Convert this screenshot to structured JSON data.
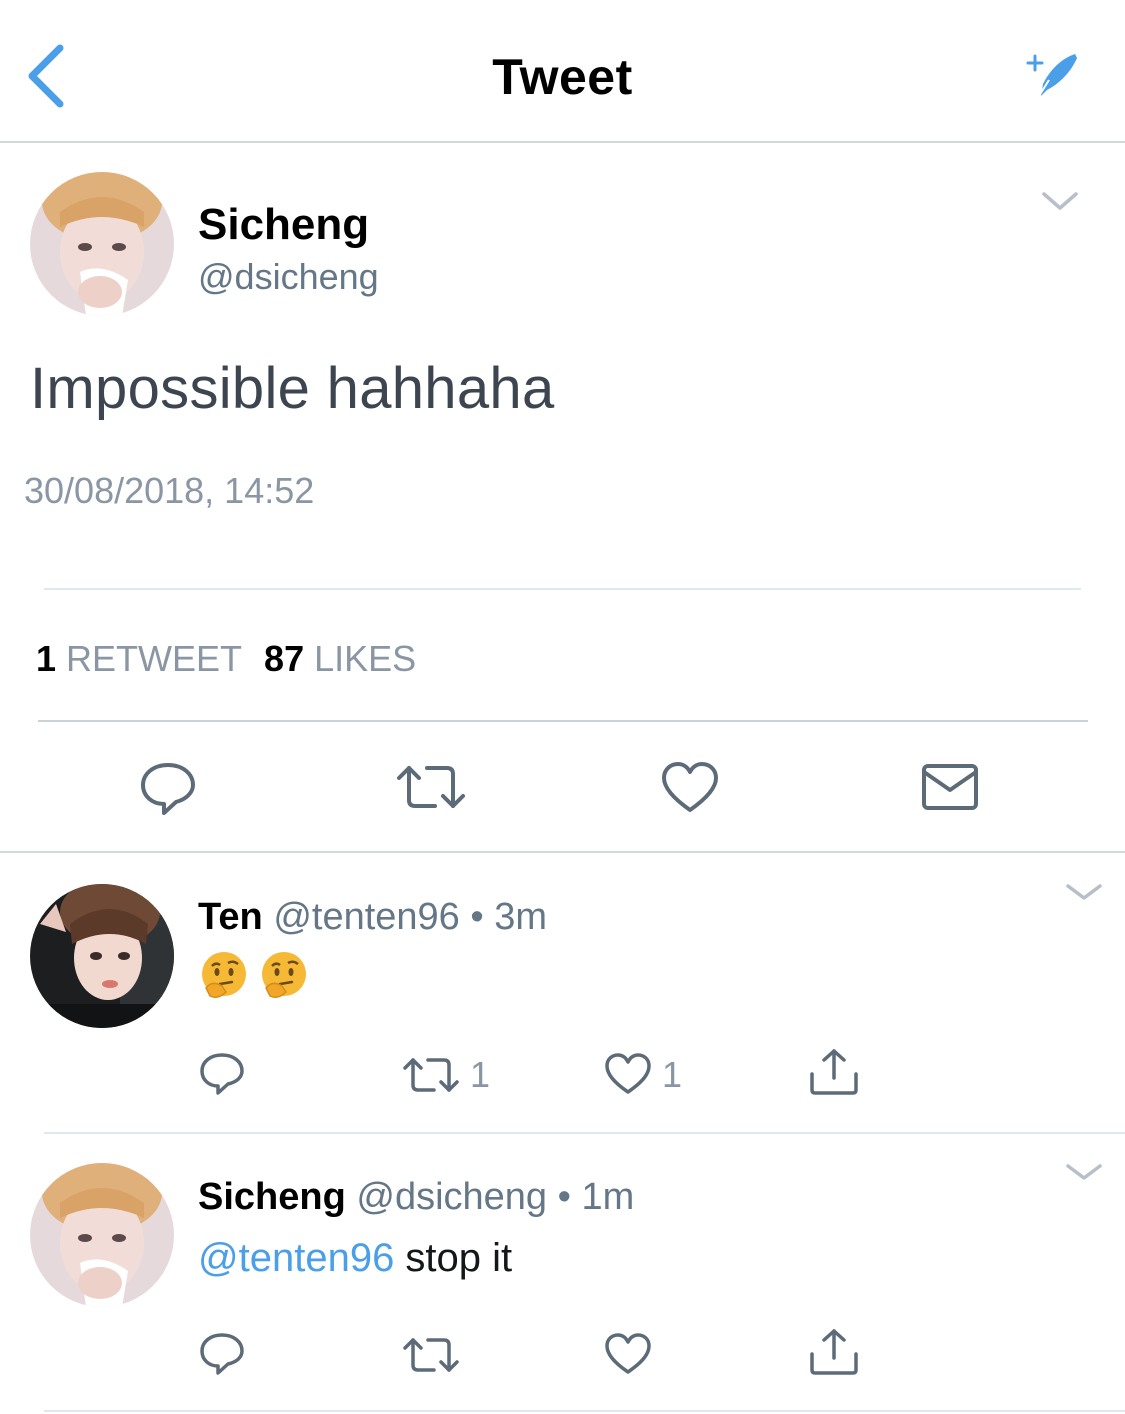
{
  "nav": {
    "title": "Tweet",
    "back_icon": "chevron-left-icon",
    "compose_icon": "compose-tweet-icon",
    "accent_color": "#4a9fe8"
  },
  "tweet": {
    "author_name": "Sicheng",
    "author_handle": "@dsicheng",
    "text": "Impossible hahhaha",
    "timestamp": "30/08/2018, 14:52",
    "retweet_count": "1",
    "retweet_label": "RETWEET",
    "like_count": "87",
    "like_label": "LIKES",
    "actions": [
      "reply-icon",
      "retweet-icon",
      "like-icon",
      "message-icon"
    ]
  },
  "replies": [
    {
      "author_name": "Ten",
      "author_handle": "@tenten96",
      "separator": "•",
      "time": "3m",
      "emojis": [
        "thinking-face-emoji",
        "thinking-face-emoji"
      ],
      "retweet_count": "1",
      "like_count": "1"
    },
    {
      "author_name": "Sicheng",
      "author_handle": "@dsicheng",
      "separator": "•",
      "time": "1m",
      "mention": "@tenten96",
      "text": " stop it",
      "retweet_count": "",
      "like_count": ""
    }
  ]
}
